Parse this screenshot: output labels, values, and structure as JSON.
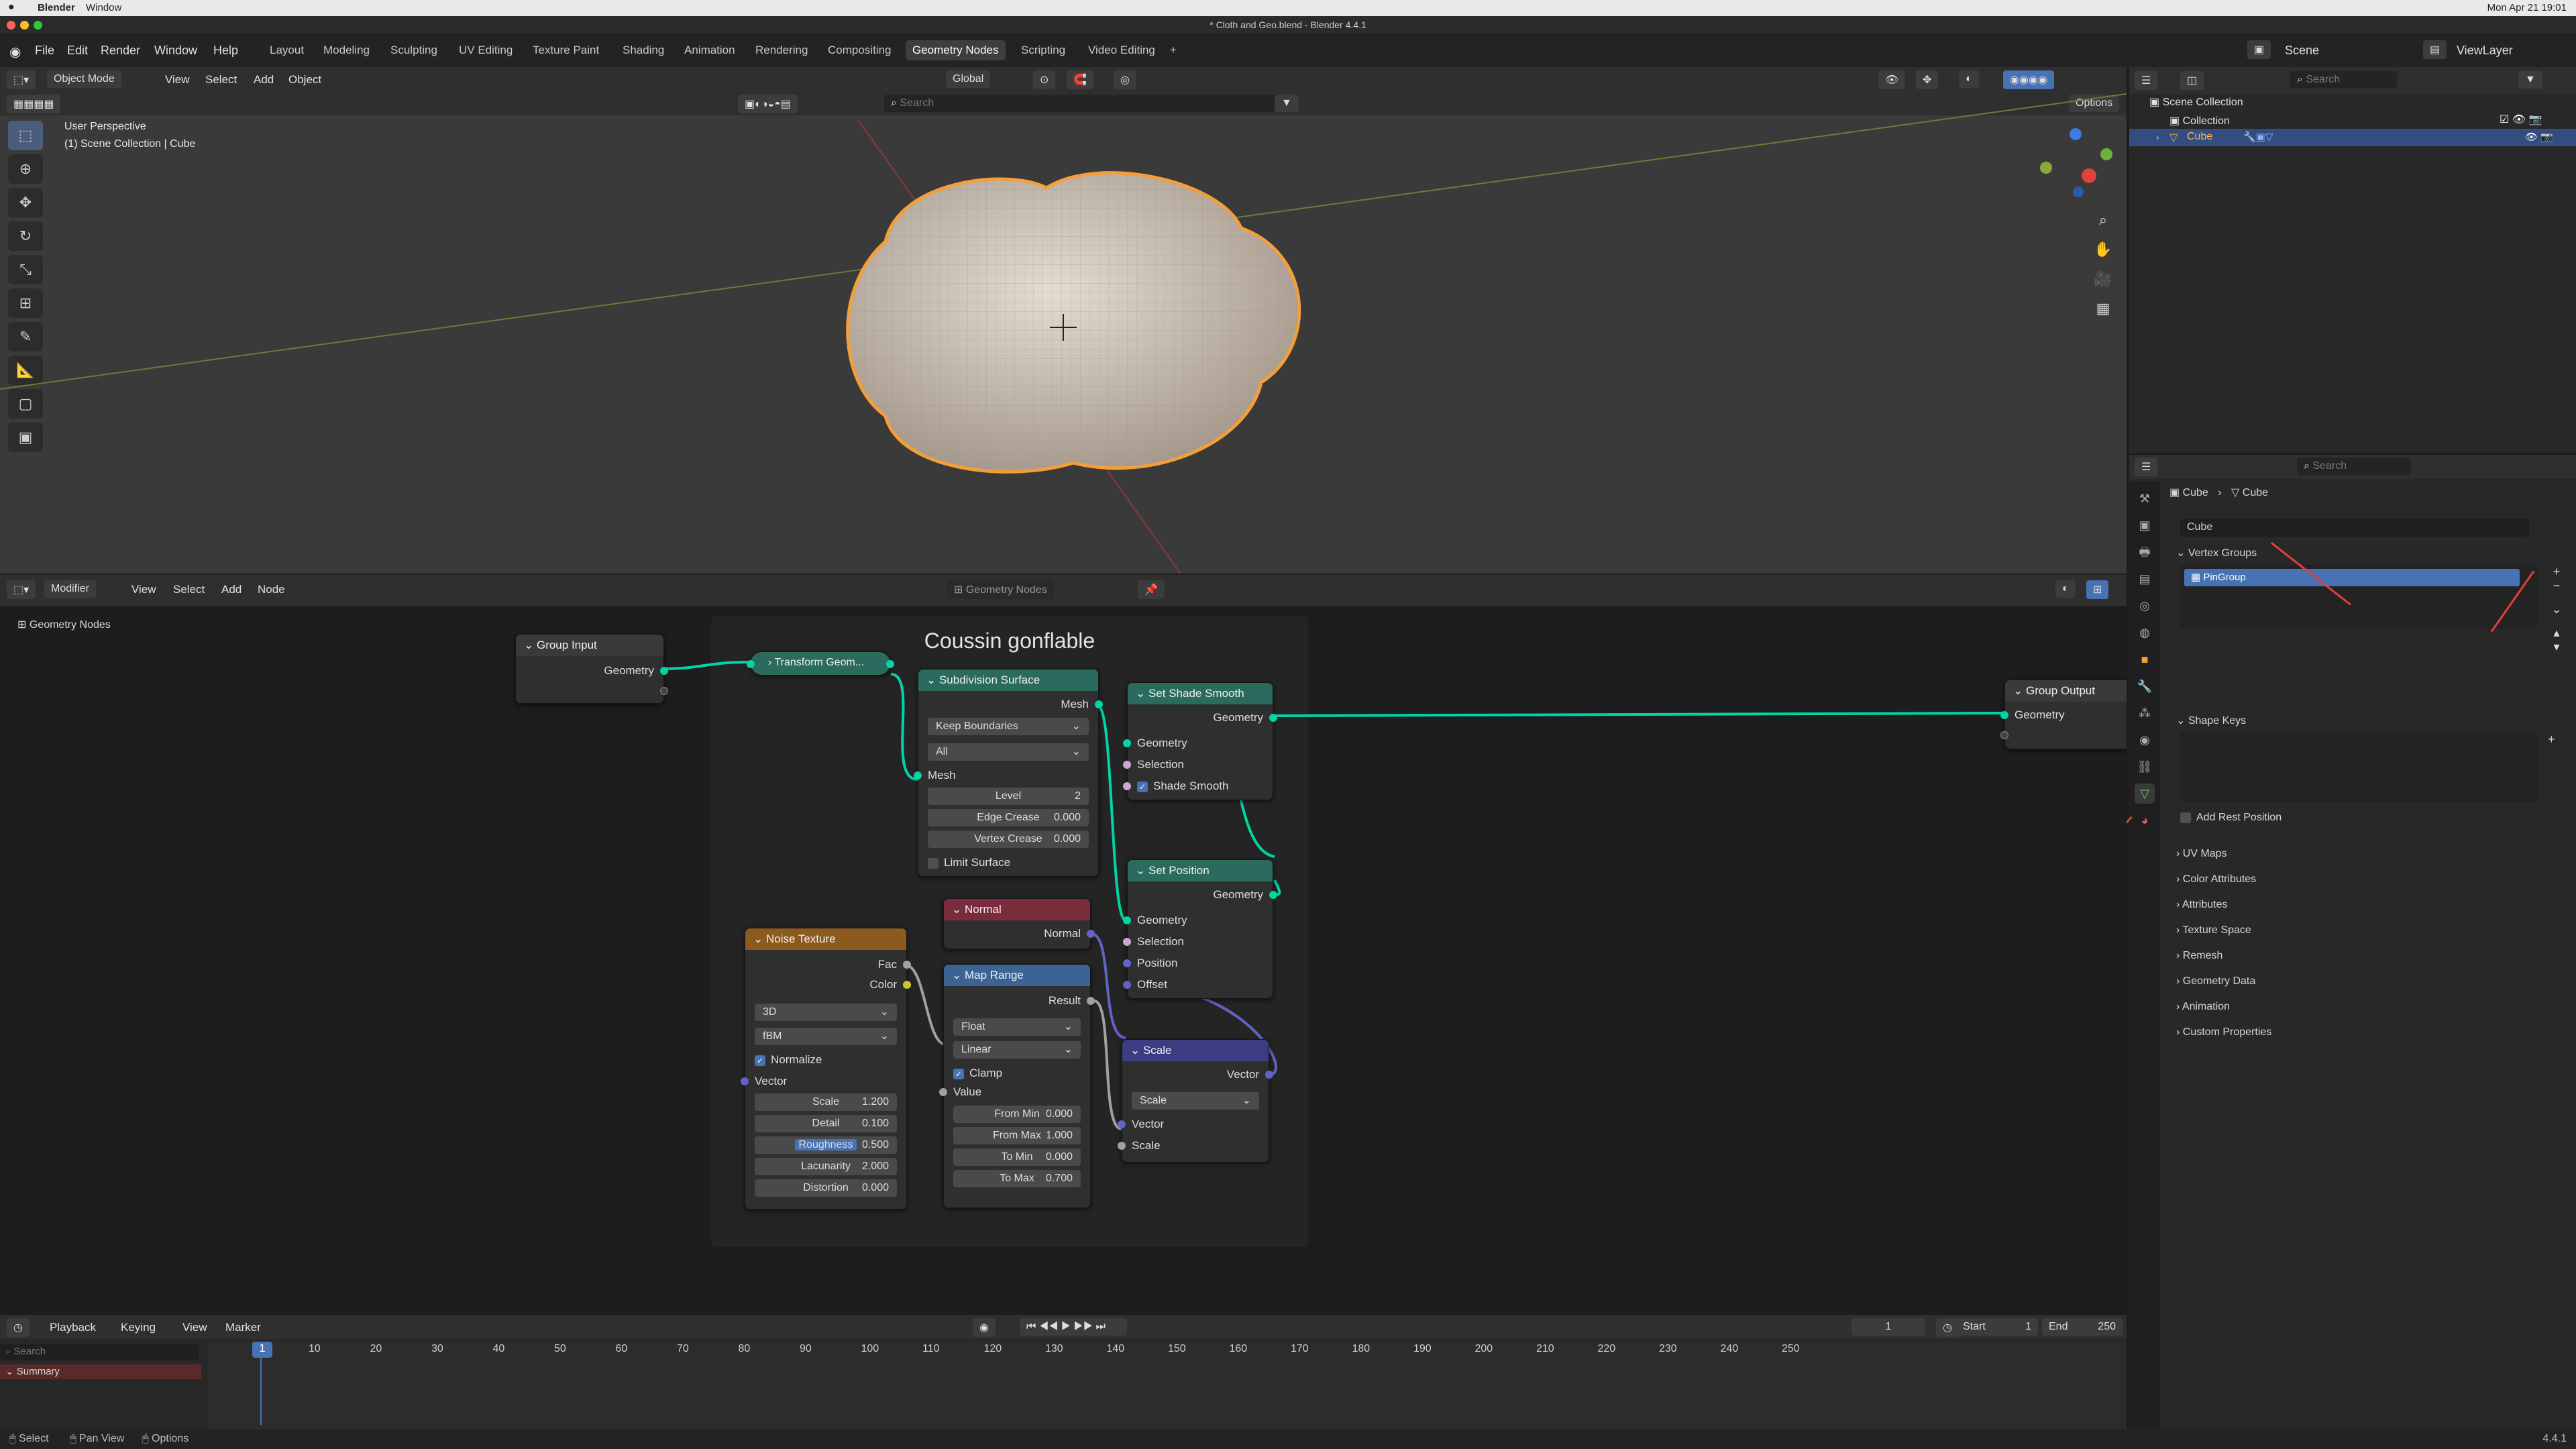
{
  "mac": {
    "app": "Blender",
    "menu": "Window",
    "clock": "Mon Apr 21 19:01"
  },
  "window_title": "* Cloth and Geo.blend - Blender 4.4.1",
  "topmenu": [
    "File",
    "Edit",
    "Render",
    "Window",
    "Help"
  ],
  "workspaces": [
    "Layout",
    "Modeling",
    "Sculpting",
    "UV Editing",
    "Texture Paint",
    "Shading",
    "Animation",
    "Rendering",
    "Compositing",
    "Geometry Nodes",
    "Scripting",
    "Video Editing"
  ],
  "active_workspace": "Geometry Nodes",
  "scene": "Scene",
  "viewlayer": "ViewLayer",
  "viewport": {
    "mode": "Object Mode",
    "menus": [
      "View",
      "Select",
      "Add",
      "Object"
    ],
    "orientation": "Global",
    "search_placeholder": "Search",
    "options": "Options",
    "info1": "User Perspective",
    "info2": "(1) Scene Collection | Cube"
  },
  "outliner": {
    "search": "Search",
    "rows": [
      "Scene Collection",
      "Collection",
      "Cube"
    ]
  },
  "props": {
    "search": "Search",
    "breadcrumb_obj": "Cube",
    "breadcrumb_data": "Cube",
    "data_name": "Cube",
    "panels": {
      "vertex_groups": "Vertex Groups",
      "shape_keys": "Shape Keys",
      "add_rest": "Add Rest Position"
    },
    "vgroup": "PinGroup",
    "collapsed": [
      "UV Maps",
      "Color Attributes",
      "Attributes",
      "Texture Space",
      "Remesh",
      "Geometry Data",
      "Animation",
      "Custom Properties"
    ]
  },
  "nodeeditor": {
    "editor": "Modifier",
    "menus": [
      "View",
      "Select",
      "Add",
      "Node"
    ],
    "tree": "Geometry Nodes",
    "breadcrumb": "Geometry Nodes",
    "frame_label": "Coussin gonflable"
  },
  "nodes": {
    "group_input": {
      "title": "Group Input",
      "out": "Geometry"
    },
    "transform": {
      "title": "Transform Geom..."
    },
    "subdiv": {
      "title": "Subdivision Surface",
      "out": "Mesh",
      "opt1": "Keep Boundaries",
      "opt2": "All",
      "in": "Mesh",
      "level_l": "Level",
      "level_v": "2",
      "edge_l": "Edge Crease",
      "edge_v": "0.000",
      "vert_l": "Vertex Crease",
      "vert_v": "0.000",
      "limit": "Limit Surface"
    },
    "shade": {
      "title": "Set Shade Smooth",
      "out": "Geometry",
      "in1": "Geometry",
      "in2": "Selection",
      "in3": "Shade Smooth"
    },
    "setpos": {
      "title": "Set Position",
      "out": "Geometry",
      "in1": "Geometry",
      "in2": "Selection",
      "in3": "Position",
      "in4": "Offset"
    },
    "normal": {
      "title": "Normal",
      "out": "Normal"
    },
    "maprange": {
      "title": "Map Range",
      "out": "Result",
      "o1": "Float",
      "o2": "Linear",
      "clamp": "Clamp",
      "value": "Value",
      "fmin_l": "From Min",
      "fmin_v": "0.000",
      "fmax_l": "From Max",
      "fmax_v": "1.000",
      "tmin_l": "To Min",
      "tmin_v": "0.000",
      "tmax_l": "To Max",
      "tmax_v": "0.700"
    },
    "noise": {
      "title": "Noise Texture",
      "fac": "Fac",
      "color": "Color",
      "o1": "3D",
      "o2": "fBM",
      "norm": "Normalize",
      "vec": "Vector",
      "scale_l": "Scale",
      "scale_v": "1.200",
      "detail_l": "Detail",
      "detail_v": "0.100",
      "rough_l": "Roughness",
      "rough_v": "0.500",
      "lac_l": "Lacunarity",
      "lac_v": "2.000",
      "dist_l": "Distortion",
      "dist_v": "0.000"
    },
    "scale": {
      "title": "Scale",
      "out": "Vector",
      "o1": "Scale",
      "in1": "Vector",
      "in2": "Scale"
    },
    "group_output": {
      "title": "Group Output",
      "in": "Geometry"
    }
  },
  "timeline": {
    "menus": [
      "Playback",
      "Keying",
      "View",
      "Marker"
    ],
    "frame": "1",
    "start_l": "Start",
    "start": "1",
    "end_l": "End",
    "end": "250",
    "summary": "Summary",
    "search": "Search",
    "ticks": [
      "1",
      "10",
      "20",
      "30",
      "40",
      "50",
      "60",
      "70",
      "80",
      "90",
      "100",
      "110",
      "120",
      "130",
      "140",
      "150",
      "160",
      "170",
      "180",
      "190",
      "200",
      "210",
      "220",
      "230",
      "240",
      "250"
    ]
  },
  "status": {
    "select": "Select",
    "pan": "Pan View",
    "options": "Options",
    "version": "4.4.1"
  },
  "colors": {
    "accent": "#4772b3",
    "geo_socket": "#00d6a3",
    "vec_socket": "#6363c7",
    "float_socket": "#a1a1a1",
    "color_socket": "#c7c729",
    "select_orange": "#f59f3a"
  }
}
